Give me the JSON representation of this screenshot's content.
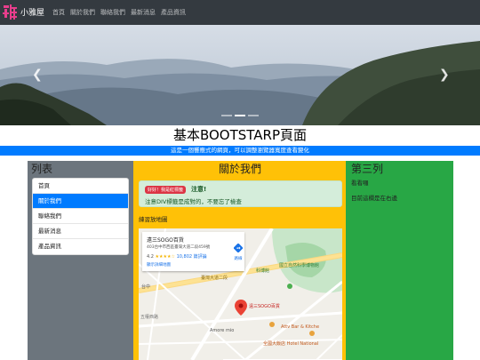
{
  "navbar": {
    "brand": "小雅屋",
    "logo_color": "#e83e8c",
    "items": [
      "首頁",
      "關於我們",
      "聯絡我們",
      "最新消息",
      "產品資訊"
    ]
  },
  "carousel": {
    "prev_icon": "chevron-left-icon",
    "next_icon": "chevron-right-icon",
    "slide_count": 3,
    "active_slide": 1
  },
  "jumbotron": {
    "title": "基本BOOTSTARP頁面",
    "subtitle": "這是一個響應式的網頁，可以調整瀏覽器寬度查看變化"
  },
  "left": {
    "heading": "列表",
    "items": [
      "首頁",
      "關於我們",
      "聯絡我們",
      "最新消息",
      "產品資訊"
    ],
    "active_index": 1
  },
  "middle": {
    "heading": "關於我們",
    "alert_badge": "好好！我是紅標籤",
    "alert_strong": "注意!",
    "alert_text": "注意DIV標籤是成對的，不要忘了檢查",
    "map_label": "練習放地圖",
    "map": {
      "place": "遠三SOGO百貨",
      "address": "403台中市西區臺灣大道二段459號",
      "rating": "4.2",
      "stars": "★★★★☆",
      "reviews": "10,802 篇評論",
      "more_link": "顯示詳細地圖",
      "route": "路線",
      "pin_label": "遠三SOGO百貨",
      "labels": [
        "國立自然科學博物館",
        "科博館",
        "台中",
        "Amore mio",
        "Attv Bar & Kitche",
        "全國大飯店 Hotel National",
        "臺灣大道二段",
        "五權西路"
      ]
    }
  },
  "right": {
    "heading": "第三列",
    "lines": [
      "看看囉",
      "目前這欄是在右邊"
    ]
  },
  "colors": {
    "navbar": "#343a40",
    "primary": "#007bff",
    "secondary": "#6c757d",
    "warning": "#ffc107",
    "success": "#28a745",
    "danger": "#dc3545"
  }
}
